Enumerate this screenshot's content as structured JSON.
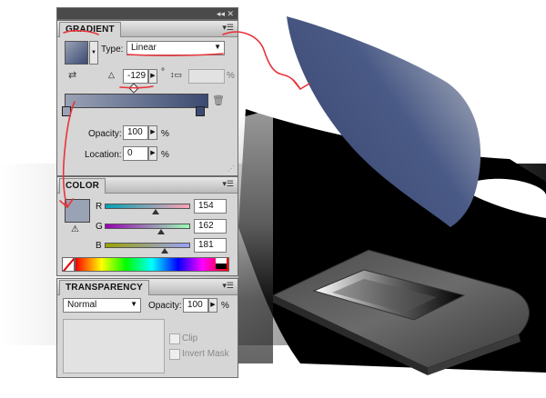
{
  "colors": {
    "panel_bg": "#d6d6d6",
    "fill_color": "#9aa2b5",
    "gradient_start": "#9aa2b5",
    "gradient_end": "#3b4a72",
    "annotation": "#e8333a"
  },
  "gradient_panel": {
    "tab": "GRADIENT",
    "type_label": "Type:",
    "type_value": "Linear",
    "angle_value": "-129",
    "angle_unit": "°",
    "aspect_unit": "%",
    "opacity_label": "Opacity:",
    "opacity_value": "100",
    "opacity_unit": "%",
    "location_label": "Location:",
    "location_value": "0",
    "location_unit": "%"
  },
  "color_panel": {
    "tab": "COLOR",
    "r_label": "R",
    "r_value": "154",
    "g_label": "G",
    "g_value": "162",
    "b_label": "B",
    "b_value": "181"
  },
  "transparency_panel": {
    "tab": "TRANSPARENCY",
    "blend_mode": "Normal",
    "opacity_label": "Opacity:",
    "opacity_value": "100",
    "opacity_unit": "%",
    "clip_label": "Clip",
    "invert_mask_label": "Invert Mask"
  },
  "icons": [
    "collapse-icon",
    "panel-menu-icon",
    "reverse-gradient-icon",
    "angle-icon",
    "aspect-ratio-icon",
    "trash-icon",
    "out-of-gamut-warning-icon",
    "none-swatch-icon"
  ]
}
